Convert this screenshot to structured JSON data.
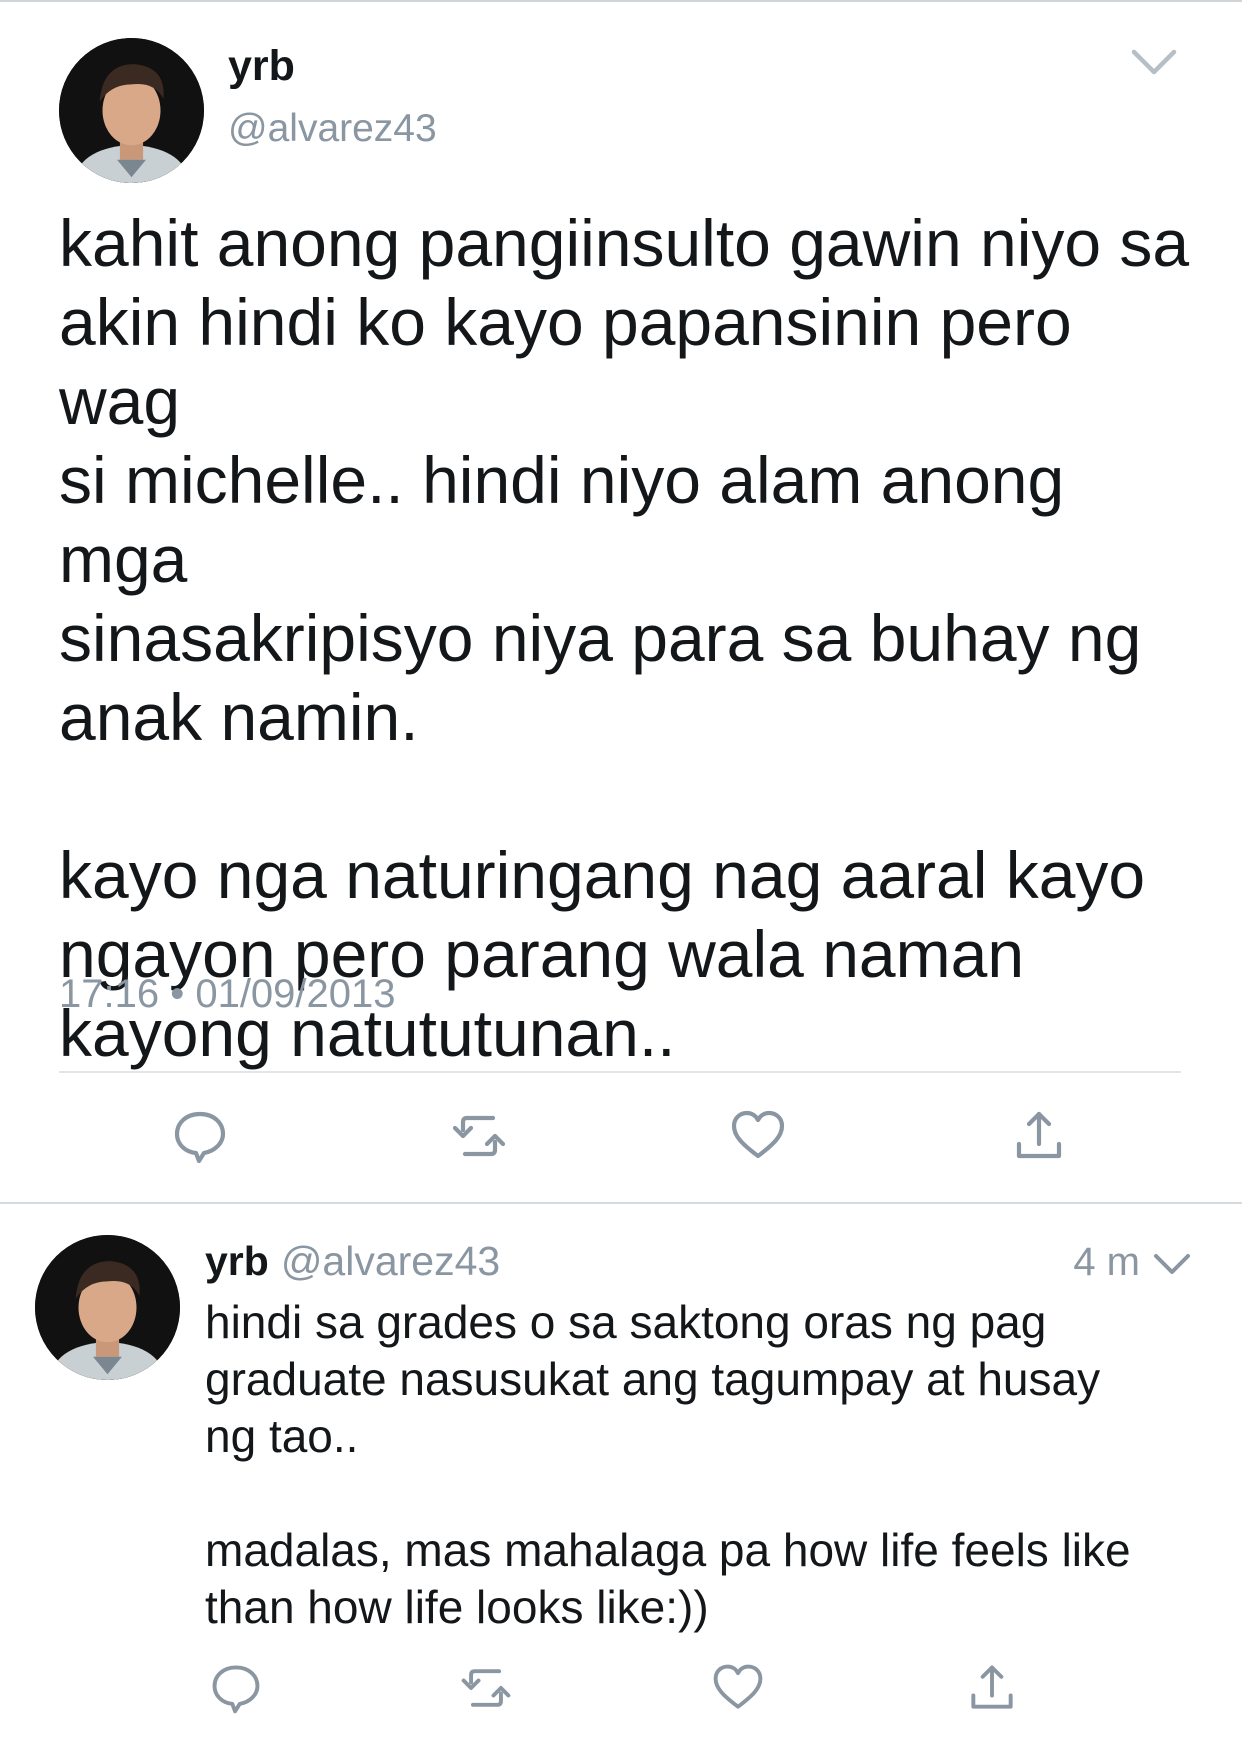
{
  "main_tweet": {
    "author": {
      "name": "yrb",
      "handle": "@alvarez43"
    },
    "text": "kahit anong pangiinsulto gawin niyo sa\nakin hindi ko kayo papansinin pero wag\nsi michelle.. hindi niyo alam anong mga\nsinasakripisyo niya para sa buhay ng\nanak namin.\n\nkayo nga naturingang nag aaral kayo\nngayon pero parang wala naman\nkayong natututunan..",
    "timestamp": "17:16 • 01/09/2013",
    "actions": [
      "reply-icon",
      "retweet-icon",
      "like-icon",
      "share-icon"
    ]
  },
  "reply_tweet": {
    "author": {
      "name": "yrb",
      "handle": "@alvarez43"
    },
    "time": "4 m",
    "text": "hindi sa grades o sa saktong oras ng pag\ngraduate nasusukat ang tagumpay at husay\nng tao..\n\nmadalas, mas mahalaga pa how life feels like\nthan how life looks like:))",
    "actions": [
      "reply-icon",
      "retweet-icon",
      "like-icon",
      "share-icon"
    ]
  },
  "colors": {
    "text_primary": "#14171a",
    "text_secondary": "#8a96a1",
    "icon_gray": "#8a96a1",
    "divider": "#e1e6ea",
    "background": "#ffffff"
  }
}
